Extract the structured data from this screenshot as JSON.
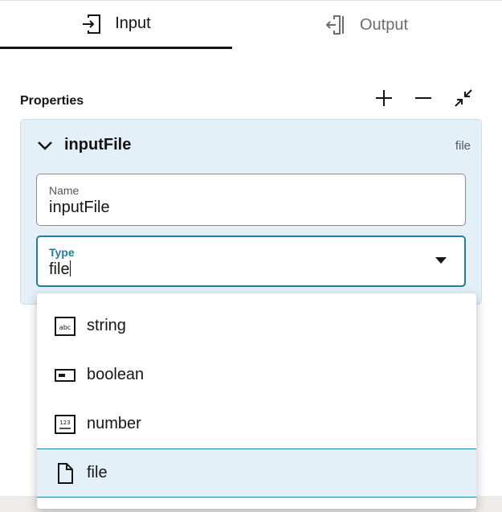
{
  "tabs": [
    {
      "label": "Input",
      "icon": "import-icon",
      "selected": true
    },
    {
      "label": "Output",
      "icon": "export-icon",
      "selected": false
    }
  ],
  "properties": {
    "title": "Properties",
    "actions": [
      {
        "icon": "plus-icon"
      },
      {
        "icon": "minus-icon"
      },
      {
        "icon": "collapse-icon"
      }
    ]
  },
  "card": {
    "title": "inputFile",
    "type_badge": "file",
    "name_field": {
      "label": "Name",
      "value": "inputFile"
    },
    "type_field": {
      "label": "Type",
      "value": "file"
    }
  },
  "type_menu": {
    "items": [
      {
        "label": "string",
        "icon": "abc-icon"
      },
      {
        "label": "boolean",
        "icon": "boolean-icon"
      },
      {
        "label": "number",
        "icon": "123-icon"
      },
      {
        "label": "file",
        "icon": "file-icon",
        "selected": true
      }
    ]
  },
  "colors": {
    "accent": "#227e9e",
    "card_bg": "#e4f0f8",
    "text": "#161513"
  }
}
